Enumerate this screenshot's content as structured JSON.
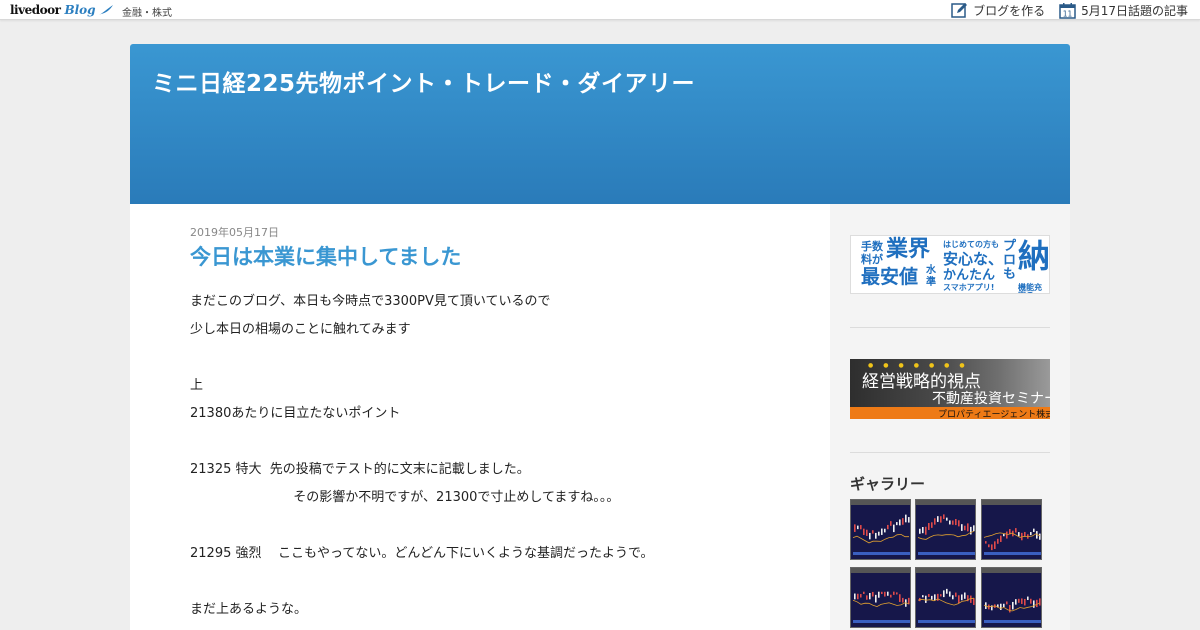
{
  "topbar": {
    "logo_text": "livedoor",
    "logo_blog": "Blog",
    "category": "金融・株式",
    "create_blog_label": "ブログを作る",
    "create_blog_icon": "edit-icon",
    "calendar_day": "11",
    "calendar_icon": "calendar-icon",
    "topic_label": "5月17日話題の記事"
  },
  "header": {
    "title": "ミニ日経225先物ポイント・トレード・ダイアリー",
    "gradient_top": "#3a97d2",
    "gradient_bottom": "#2a7bb9"
  },
  "post": {
    "date": "2019年05月17日",
    "title": "今日は本業に集中してました",
    "lines": [
      "まだこのブログ、本日も今時点で3300PV見て頂いているので",
      "少し本日の相場のことに触れてみます",
      "",
      "上",
      "21380あたりに目立たないポイント",
      "",
      "21325 特大  先の投稿でテスト的に文末に記載しました。",
      "                         その影響か不明ですが、21300で寸止めしてますね。。。",
      "",
      "21295 強烈    ここもやってない。どんどん下にいくような基調だったようで。",
      "",
      "まだ上あるような。"
    ]
  },
  "sidebar": {
    "ad1": {
      "t1": "手数",
      "t2": "料が",
      "t3": "業界",
      "t4": "最安値",
      "t5": "水",
      "t6": "準",
      "t7": "はじめての方も",
      "t8": "安心な、",
      "t9": "かんたん",
      "t10": "スマホアプリ!",
      "t11": "プ",
      "t12": "ロ",
      "t13": "も",
      "t14": "納",
      "t15": "機能充実の"
    },
    "ad2": {
      "dots": "●●●●●●●",
      "main": "経営戦略的視点",
      "sub": "不動産投資セミナー",
      "bar": "プロパティエージェント株式会社"
    },
    "gallery_title": "ギャラリー",
    "gallery_count": 6
  },
  "colors": {
    "accent": "#3a97d2",
    "ad_orange": "#ee7a16"
  }
}
